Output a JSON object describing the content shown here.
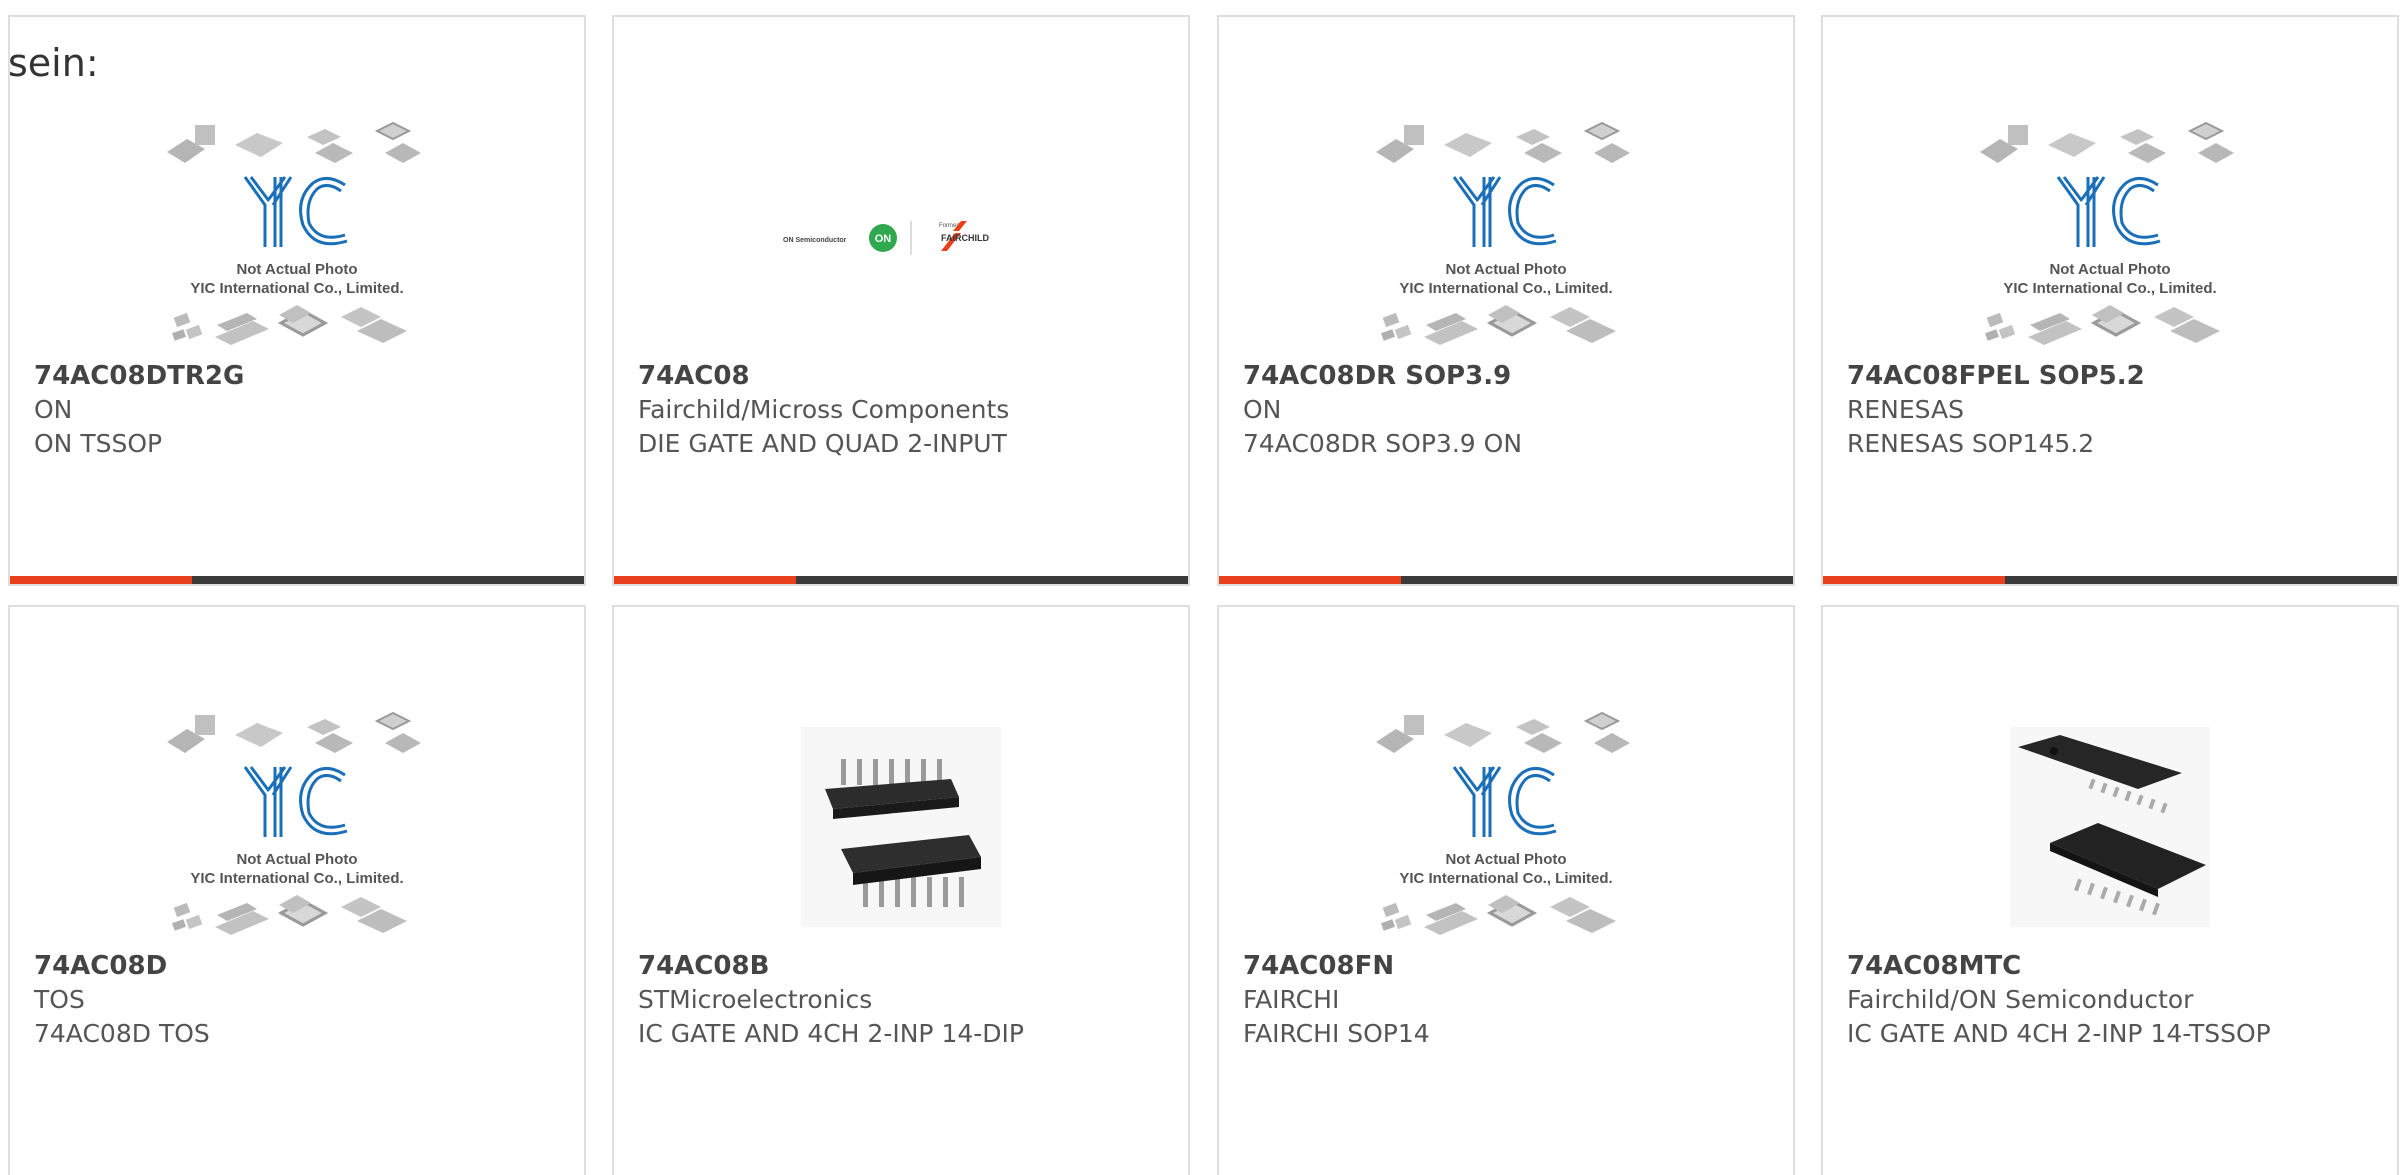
{
  "heading": "sein:",
  "placeholder": {
    "line1": "Not Actual Photo",
    "line2": "YIC International Co., Limited.",
    "logo": "YIC"
  },
  "onsemi_logo": {
    "left_text": "ON Semiconductor",
    "badge": "ON",
    "formerly": "Formerly",
    "fairchild": "FAIRCHILD"
  },
  "products": [
    {
      "part": "74AC08DTR2G",
      "mfr": "ON",
      "desc": "ON TSSOP",
      "image": "placeholder"
    },
    {
      "part": "74AC08",
      "mfr": "Fairchild/Micross Components",
      "desc": "DIE GATE AND QUAD 2-INPUT",
      "image": "onsemi-fairchild-logo"
    },
    {
      "part": "74AC08DR SOP3.9",
      "mfr": "ON",
      "desc": "74AC08DR SOP3.9 ON",
      "image": "placeholder"
    },
    {
      "part": "74AC08FPEL SOP5.2",
      "mfr": "RENESAS",
      "desc": "RENESAS SOP145.2",
      "image": "placeholder"
    },
    {
      "part": "74AC08D",
      "mfr": "TOS",
      "desc": "74AC08D TOS",
      "image": "placeholder"
    },
    {
      "part": "74AC08B",
      "mfr": "STMicroelectronics",
      "desc": "IC GATE AND 4CH 2-INP 14-DIP",
      "image": "dip-14-chip"
    },
    {
      "part": "74AC08FN",
      "mfr": "FAIRCHI",
      "desc": "FAIRCHI SOP14",
      "image": "placeholder"
    },
    {
      "part": "74AC08MTC",
      "mfr": "Fairchild/ON Semiconductor",
      "desc": "IC GATE AND 4CH 2-INP 14-TSSOP",
      "image": "tssop-14-chip"
    }
  ],
  "colors": {
    "accent": "#e8401c",
    "bar": "#3a3a3a",
    "border": "#dedede",
    "yic_blue": "#1a6fb8"
  }
}
